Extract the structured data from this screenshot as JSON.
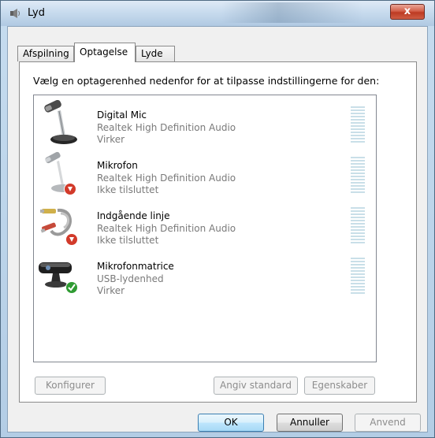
{
  "window": {
    "title": "Lyd",
    "close_label": "x",
    "colors": {
      "titlebar": "#c8dbee",
      "close": "#c4452d"
    }
  },
  "tabs": [
    {
      "label": "Afspilning",
      "active": false
    },
    {
      "label": "Optagelse",
      "active": true
    },
    {
      "label": "Lyde",
      "active": false
    }
  ],
  "instruction": "Vælg en optagerenhed nedenfor for at tilpasse indstillingerne for den:",
  "devices": [
    {
      "name": "Digital Mic",
      "driver": "Realtek High Definition Audio",
      "status": "Virker",
      "icon": "desk-microphone-icon",
      "badge": ""
    },
    {
      "name": "Mikrofon",
      "driver": "Realtek High Definition Audio",
      "status": "Ikke tilsluttet",
      "icon": "microphone-icon",
      "badge": "down-arrow-badge-icon"
    },
    {
      "name": "Indgående linje",
      "driver": "Realtek High Definition Audio",
      "status": "Ikke tilsluttet",
      "icon": "rca-cable-icon",
      "badge": "down-arrow-badge-icon"
    },
    {
      "name": "Mikrofonmatrice",
      "driver": "USB-lydenhed",
      "status": "Virker",
      "icon": "webcam-microphone-array-icon",
      "badge": "green-check-badge-icon"
    }
  ],
  "buttons": {
    "configure": "Konfigurer",
    "set_default": "Angiv standard",
    "properties": "Egenskaber",
    "ok": "OK",
    "cancel": "Annuller",
    "apply": "Anvend"
  }
}
